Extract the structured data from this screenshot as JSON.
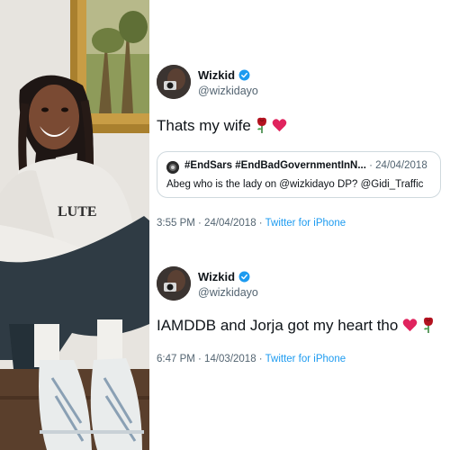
{
  "tweet1": {
    "name": "Wizkid",
    "handle": "@wizkidayo",
    "text": "Thats my wife",
    "quote": {
      "name": "#EndSars #EndBadGovernmentInN...",
      "date": "· 24/04/2018",
      "text": "Abeg who is the lady on @wizkidayo DP? @Gidi_Traffic"
    },
    "timestamp": "3:55 PM · 24/04/2018 · ",
    "client": "Twitter for iPhone"
  },
  "tweet2": {
    "name": "Wizkid",
    "handle": "@wizkidayo",
    "text": "IAMDDB and Jorja got my heart tho",
    "timestamp": "6:47 PM · 14/03/2018 · ",
    "client": "Twitter for iPhone"
  },
  "colors": {
    "verified": "#1d9bf0",
    "link": "#1d9bf0",
    "muted": "#536471",
    "heart": "#e0245e",
    "rose": "#b3121f"
  },
  "icons": [
    "verified-badge-icon",
    "rose-emoji-icon",
    "red-heart-emoji-icon"
  ]
}
